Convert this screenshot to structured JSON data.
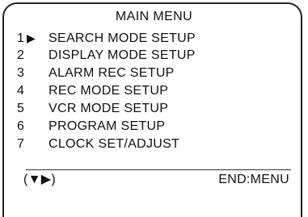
{
  "menu": {
    "title": "MAIN MENU",
    "cursor_symbol": "▶",
    "items": [
      {
        "number": "1",
        "label": "SEARCH MODE  SETUP",
        "selected": true
      },
      {
        "number": "2",
        "label": "DISPLAY MODE SETUP",
        "selected": false
      },
      {
        "number": "3",
        "label": "ALARM REC SETUP",
        "selected": false
      },
      {
        "number": "4",
        "label": "REC MODE SETUP",
        "selected": false
      },
      {
        "number": "5",
        "label": "VCR MODE SETUP",
        "selected": false
      },
      {
        "number": "6",
        "label": "PROGRAM SETUP",
        "selected": false
      },
      {
        "number": "7",
        "label": "CLOCK SET/ADJUST",
        "selected": false
      }
    ]
  },
  "footer": {
    "navigation_hint": "(▼▶)",
    "exit_hint": "END:MENU"
  }
}
